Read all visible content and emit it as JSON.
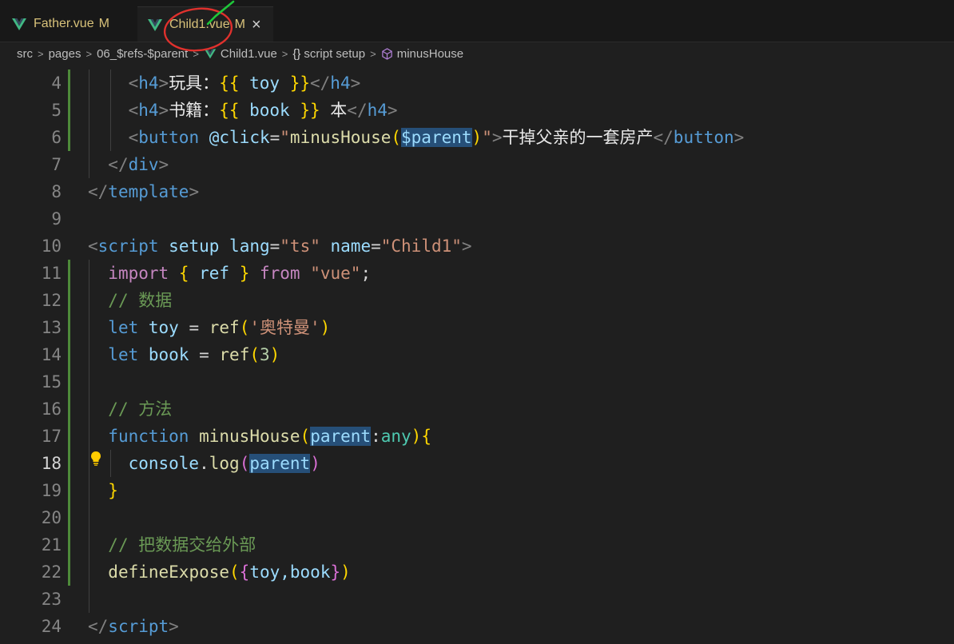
{
  "tabs": [
    {
      "name": "Father.vue",
      "status": "M"
    },
    {
      "name": "Child1.vue",
      "status": "M",
      "close": "×"
    }
  ],
  "breadcrumb": {
    "items": [
      "src",
      "pages",
      "06_$refs-$parent",
      "Child1.vue",
      "script setup",
      "minusHouse"
    ],
    "separator": ">",
    "script_icon": "{}"
  },
  "editor": {
    "active_line": "18",
    "lines": [
      {
        "n": "4"
      },
      {
        "n": "5"
      },
      {
        "n": "6"
      },
      {
        "n": "7"
      },
      {
        "n": "8"
      },
      {
        "n": "9"
      },
      {
        "n": "10"
      },
      {
        "n": "11"
      },
      {
        "n": "12"
      },
      {
        "n": "13"
      },
      {
        "n": "14"
      },
      {
        "n": "15"
      },
      {
        "n": "16"
      },
      {
        "n": "17"
      },
      {
        "n": "18"
      },
      {
        "n": "19"
      },
      {
        "n": "20"
      },
      {
        "n": "21"
      },
      {
        "n": "22"
      },
      {
        "n": "23"
      },
      {
        "n": "24"
      }
    ],
    "code": {
      "l4": {
        "open": "<",
        "tag": "h4",
        "close": ">",
        "label": "玩具：",
        "lb": "{{",
        "expr": " toy ",
        "rb": "}}",
        "end_open": "</",
        "end_tag": "h4",
        "end_close": ">"
      },
      "l5": {
        "open": "<",
        "tag": "h4",
        "close": ">",
        "label": "书籍：",
        "lb": "{{",
        "expr": " book ",
        "rb": "}}",
        "unit": " 本",
        "end_open": "</",
        "end_tag": "h4",
        "end_close": ">"
      },
      "l6": {
        "open": "<",
        "tag": "button",
        "attr": "@click",
        "eq": "=",
        "q1": "\"",
        "fn": "minusHouse",
        "lp": "(",
        "arg": "$parent",
        "rp": ")",
        "q2": "\"",
        "close": ">",
        "text": "干掉父亲的一套房产",
        "end_open": "</",
        "end_tag": "button",
        "end_close": ">"
      },
      "l7": {
        "open": "</",
        "tag": "div",
        "close": ">"
      },
      "l8": {
        "open": "</",
        "tag": "template",
        "close": ">"
      },
      "l10": {
        "open": "<",
        "tag": "script",
        "a1": "setup",
        "a2": "lang",
        "v2": "\"ts\"",
        "a3": "name",
        "v3": "\"Child1\"",
        "close": ">"
      },
      "l11": {
        "kw": "import",
        "lb": "{",
        "name": " ref ",
        "rb": "}",
        "from": "from",
        "mod": "\"vue\"",
        "semi": ";"
      },
      "l12": {
        "comment": "// 数据"
      },
      "l13": {
        "kw": "let",
        "var": "toy",
        "eq": " = ",
        "fn": "ref",
        "lp": "(",
        "str": "'奥特曼'",
        "rp": ")"
      },
      "l14": {
        "kw": "let",
        "var": "book",
        "eq": " = ",
        "fn": "ref",
        "lp": "(",
        "num": "3",
        "rp": ")"
      },
      "l16": {
        "comment": "// 方法"
      },
      "l17": {
        "kw": "function",
        "fn": "minusHouse",
        "lp": "(",
        "param": "parent",
        "colon": ":",
        "type": "any",
        "rp": ")",
        "brace": "{"
      },
      "l18": {
        "obj": "console",
        "dot": ".",
        "fn": "log",
        "lp": "(",
        "param": "parent",
        "rp": ")"
      },
      "l19": {
        "brace": "}"
      },
      "l21": {
        "comment": "// 把数据交给外部"
      },
      "l22": {
        "fn": "defineExpose",
        "lp": "(",
        "lb": "{",
        "items": "toy,book",
        "rb": "}",
        "rp": ")"
      },
      "l24": {
        "open": "</",
        "tag": "script",
        "close": ">"
      }
    }
  },
  "colors": {
    "modified_gutter": "#4e8a3a",
    "vue_green": "#41b883",
    "annotation_red": "#e0312d"
  }
}
